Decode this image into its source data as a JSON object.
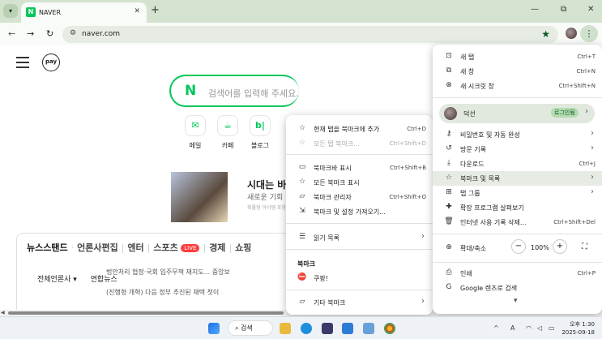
{
  "tab": {
    "title": "NAVER",
    "favicon": "N"
  },
  "toolbar": {
    "url": "naver.com"
  },
  "page": {
    "pay": "pay",
    "search_logo": "N",
    "search_placeholder": "검색어를 입력해 주세요.",
    "services": [
      {
        "icon": "mail-icon",
        "glyph": "✉",
        "label": "메일"
      },
      {
        "icon": "cafe-icon",
        "glyph": "☕",
        "label": "카페"
      },
      {
        "icon": "blog-icon",
        "glyph": "b|",
        "label": "블로그"
      }
    ],
    "banner": {
      "title": "시대는 바",
      "sub": "새로운 기회",
      "fine": "확률형 아이템 포함"
    },
    "news": {
      "tab1": "뉴스스탠드",
      "tab2": "언론사편집",
      "tab3": "엔터",
      "tab4": "스포츠",
      "live": "LIVE",
      "tab5": "경제",
      "tab6": "쇼핑",
      "sub1": "전체언론사",
      "sub2": "연합뉴스",
      "line1": "법안처리 협정·국회 입주무책 재지도... 중앙보",
      "line2": "(진행형 개혁) 다음 정부 추진된 재택 첫이"
    }
  },
  "bookmark_menu": {
    "items": [
      {
        "icon": "star-icon",
        "glyph": "☆",
        "label": "현재 탭을 북마크에 추가",
        "shortcut": "Ctrl+D"
      },
      {
        "icon": "star-icon",
        "glyph": "☆",
        "label": "모든 탭 북마크...",
        "shortcut": "Ctrl+Shift+D",
        "disabled": true
      },
      {
        "icon": "bookmark-bar-icon",
        "glyph": "▭",
        "label": "북마크바 표시",
        "shortcut": "Ctrl+Shift+B"
      },
      {
        "icon": "star-icon",
        "glyph": "☆",
        "label": "모든 북마크 표시",
        "shortcut": ""
      },
      {
        "icon": "folder-icon",
        "glyph": "▱",
        "label": "북마크 관리자",
        "shortcut": "Ctrl+Shift+O"
      },
      {
        "icon": "import-icon",
        "glyph": "⇲",
        "label": "북마크 및 설정 가져오기...",
        "shortcut": ""
      }
    ],
    "reading": "읽기 목록",
    "heading": "북마크",
    "coupang": "쿠팡!",
    "other": "기타 북마크"
  },
  "main_menu": {
    "top": [
      {
        "icon": "new-tab-icon",
        "glyph": "⊡",
        "label": "새 탭",
        "shortcut": "Ctrl+T"
      },
      {
        "icon": "new-window-icon",
        "glyph": "⧉",
        "label": "새 창",
        "shortcut": "Ctrl+N"
      },
      {
        "icon": "incognito-icon",
        "glyph": "⊗",
        "label": "새 시크릿 창",
        "shortcut": "Ctrl+Shift+N"
      }
    ],
    "profile": {
      "name": "덕선",
      "badge": "로그인됨"
    },
    "mid": [
      {
        "icon": "key-icon",
        "glyph": "⚷",
        "label": "비밀번호 및 자동 완성",
        "shortcut": "",
        "arrow": true
      },
      {
        "icon": "history-icon",
        "glyph": "↺",
        "label": "방문 기록",
        "shortcut": "",
        "arrow": true
      },
      {
        "icon": "download-icon",
        "glyph": "⤓",
        "label": "다운로드",
        "shortcut": "Ctrl+J",
        "arrow": false
      },
      {
        "icon": "star-icon",
        "glyph": "☆",
        "label": "북마크 및 목록",
        "shortcut": "",
        "arrow": true,
        "highlight": true
      },
      {
        "icon": "tab-group-icon",
        "glyph": "⊞",
        "label": "탭 그룹",
        "shortcut": "",
        "arrow": true
      },
      {
        "icon": "extension-icon",
        "glyph": "✚",
        "label": "확장 프로그램 살펴보기",
        "shortcut": "",
        "arrow": false
      },
      {
        "icon": "trash-icon",
        "glyph": "🗑",
        "label": "인터넷 사용 기록 삭제...",
        "shortcut": "Ctrl+Shift+Del",
        "arrow": false
      }
    ],
    "zoom": {
      "label": "확대/축소",
      "value": "100%",
      "minus": "−",
      "plus": "+"
    },
    "bottom": [
      {
        "icon": "print-icon",
        "glyph": "⎙",
        "label": "인쇄",
        "shortcut": "Ctrl+P"
      },
      {
        "icon": "lens-icon",
        "glyph": "G",
        "label": "Google 렌즈로 검색",
        "shortcut": ""
      }
    ],
    "more": "▾"
  },
  "taskbar": {
    "search": "검색",
    "time": "오후 1:30",
    "date": "2025-09-18",
    "lang": "A"
  }
}
